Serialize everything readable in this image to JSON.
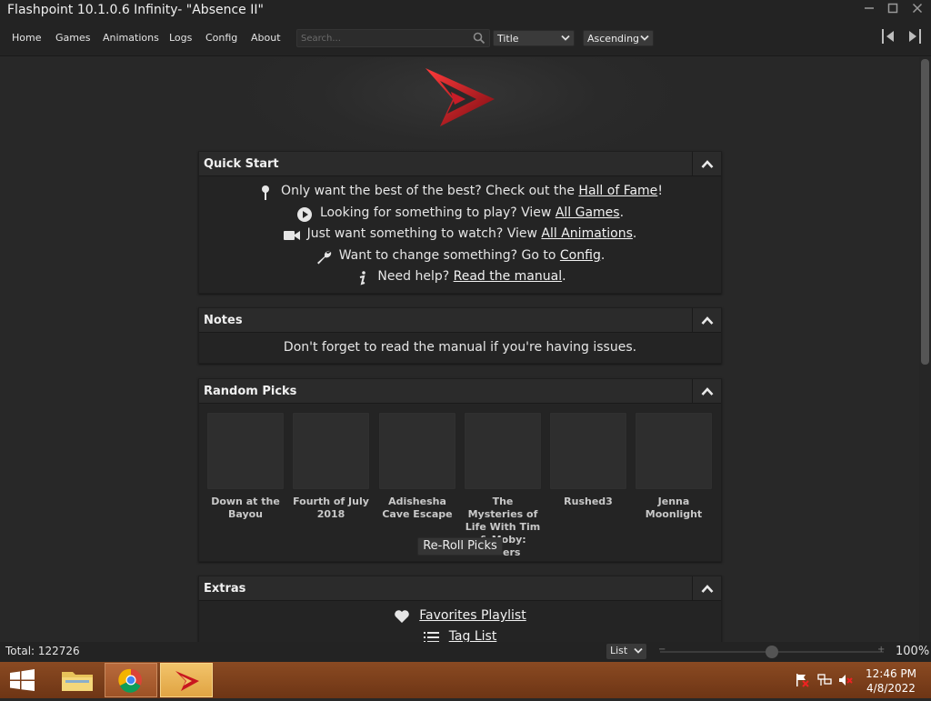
{
  "window": {
    "title": "Flashpoint 10.1.0.6 Infinity- \"Absence II\""
  },
  "menu": {
    "items": [
      {
        "label": "Home"
      },
      {
        "label": "Games"
      },
      {
        "label": "Animations"
      },
      {
        "label": "Logs"
      },
      {
        "label": "Config"
      },
      {
        "label": "About"
      }
    ],
    "search_placeholder": "Search...",
    "sort_field": "Title",
    "sort_order": "Ascending"
  },
  "quick_start": {
    "title": "Quick Start",
    "lines": [
      {
        "icon": "award-icon",
        "prefix": "Only want the best of the best? Check out the ",
        "link": "Hall of Fame",
        "suffix": "!"
      },
      {
        "icon": "play-icon",
        "prefix": "Looking for something to play? View ",
        "link": "All Games",
        "suffix": "."
      },
      {
        "icon": "video-camera-icon",
        "prefix": "Just want something to watch? View ",
        "link": "All Animations",
        "suffix": "."
      },
      {
        "icon": "wrench-icon",
        "prefix": "Want to change something? Go to ",
        "link": "Config",
        "suffix": "."
      },
      {
        "icon": "info-icon",
        "prefix": "Need help? ",
        "link": "Read the manual",
        "suffix": "."
      }
    ]
  },
  "notes": {
    "title": "Notes",
    "text": "Don't forget to read the manual if you're having issues."
  },
  "random_picks": {
    "title": "Random Picks",
    "games": [
      {
        "title": "Down at the Bayou"
      },
      {
        "title": "Fourth of July 2018"
      },
      {
        "title": "Adishesha Cave Escape"
      },
      {
        "title": "The Mysteries of Life With Tim & Moby: Rivers"
      },
      {
        "title": "Rushed3"
      },
      {
        "title": "Jenna Moonlight"
      }
    ],
    "reroll_label": "Re-Roll Picks"
  },
  "extras": {
    "title": "Extras",
    "items": [
      {
        "icon": "heart-icon",
        "label": "Favorites Playlist"
      },
      {
        "icon": "list-icon",
        "label": "Tag List"
      }
    ]
  },
  "status": {
    "total": "Total: 122726",
    "view_mode": "List",
    "zoom": "100%",
    "zoom_level": 0.5
  },
  "taskbar": {
    "time": "12:46 PM",
    "date": "4/8/2022"
  },
  "colors": {
    "background": "#282828",
    "panel": "#242424",
    "accent_logo": "#d01f2c"
  }
}
